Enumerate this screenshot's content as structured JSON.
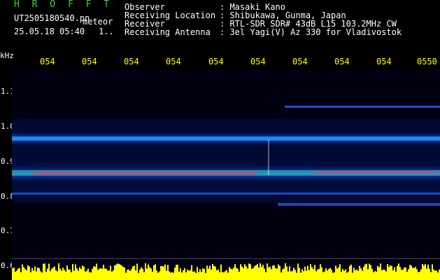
{
  "header": {
    "title": "H R O F F T",
    "filename": "UT2505180540.pn",
    "small_label": "meteor",
    "datetime": "25.05.18 05:40",
    "page": "1.."
  },
  "info": {
    "rows": [
      {
        "label": "Observer",
        "value": ": Masaki Kano"
      },
      {
        "label": "Receiving Location",
        "value": ": Shibukawa, Gunma, Japan"
      },
      {
        "label": "Receiver",
        "value": ": RTL-SDR SDR# 43dB L15 103.2MHz CW"
      },
      {
        "label": "Receiving Antenna",
        "value": ": 3el Yagi(V) Az 330 for Vladivostok"
      }
    ]
  },
  "axis": {
    "unit": "kHz",
    "x_ticks": [
      "054",
      "054",
      "054",
      "054",
      "054",
      "054",
      "054",
      "054",
      "054",
      "0550"
    ],
    "y_ticks": [
      "1.1",
      "1.0",
      "0.9",
      "0.8",
      "0.7",
      "0.6"
    ]
  },
  "colors": {
    "title_green": "#3cd23c",
    "tick_yellow": "#ffff00",
    "signal_yellow": "#ffff00",
    "background": "#000000"
  }
}
